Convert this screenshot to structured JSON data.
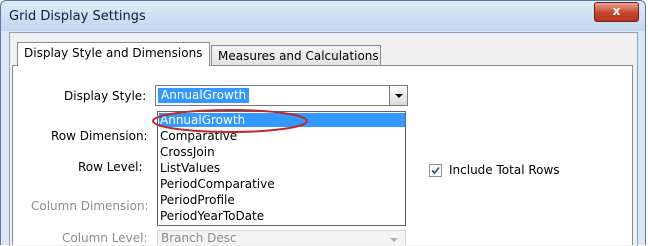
{
  "window": {
    "title": "Grid Display Settings",
    "close_glyph": "x"
  },
  "tabs": [
    {
      "label": "Display Style and Dimensions",
      "active": true
    },
    {
      "label": "Measures and Calculations",
      "active": false
    }
  ],
  "form": {
    "display_style": {
      "label": "Display Style:",
      "value": "AnnualGrowth"
    },
    "row_dimension": {
      "label": "Row Dimension:"
    },
    "row_level": {
      "label": "Row Level:"
    },
    "column_dimension": {
      "label": "Column Dimension:"
    },
    "column_level": {
      "label": "Column Level:",
      "value": "Branch Desc"
    },
    "include_total_rows": {
      "label": "Include Total Rows",
      "checked": true
    }
  },
  "dropdown": {
    "options": [
      "AnnualGrowth",
      "Comparative",
      "CrossJoin",
      "ListValues",
      "PeriodComparative",
      "PeriodProfile",
      "PeriodYearToDate"
    ],
    "selected": "AnnualGrowth"
  },
  "colors": {
    "selection": "#3399ff",
    "annotation": "#c0282a",
    "close_button": "#c7452e"
  }
}
